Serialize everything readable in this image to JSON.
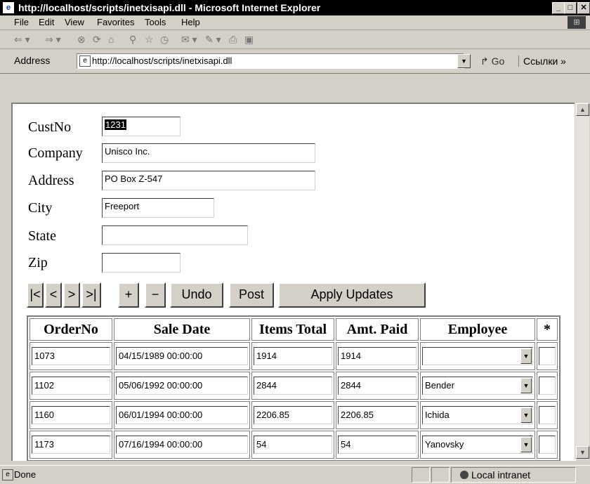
{
  "window": {
    "title": "http://localhost/scripts/inetxisapi.dll - Microsoft Internet Explorer",
    "title_icon": "ie-page-icon",
    "min_icon": "_",
    "max_icon": "□",
    "close_icon": "✕"
  },
  "menu": {
    "items": [
      "File",
      "Edit",
      "View",
      "Favorites",
      "Tools",
      "Help"
    ]
  },
  "toolbar": {
    "icons": [
      "back-icon",
      "forward-icon",
      "stop-icon",
      "refresh-icon",
      "home-icon",
      "search-icon",
      "favorites-icon",
      "history-icon",
      "mail-icon",
      "print-icon",
      "edit-icon"
    ]
  },
  "address": {
    "label": "Address",
    "url": "http://localhost/scripts/inetxisapi.dll",
    "go": "Go",
    "links": "Ссылки »"
  },
  "form": {
    "fields": [
      {
        "label": "CustNo",
        "value": "1231"
      },
      {
        "label": "Company",
        "value": "Unisco Inc."
      },
      {
        "label": "Address",
        "value": "PO Box Z-547"
      },
      {
        "label": "City",
        "value": "Freeport"
      },
      {
        "label": "State",
        "value": ""
      },
      {
        "label": "Zip",
        "value": ""
      }
    ]
  },
  "nav_buttons": {
    "first": "|<",
    "prev": "<",
    "next": ">",
    "last": ">|",
    "insert": "+",
    "delete": "−",
    "undo": "Undo",
    "post": "Post",
    "apply": "Apply Updates"
  },
  "grid": {
    "headers": [
      "OrderNo",
      "Sale Date",
      "Items Total",
      "Amt. Paid",
      "Employee",
      "*"
    ],
    "rows": [
      {
        "order": "1073",
        "date": "04/15/1989 00:00:00",
        "items": "1914",
        "paid": "1914",
        "employee": ""
      },
      {
        "order": "1102",
        "date": "05/06/1992 00:00:00",
        "items": "2844",
        "paid": "2844",
        "employee": "Bender"
      },
      {
        "order": "1160",
        "date": "06/01/1994 00:00:00",
        "items": "2206.85",
        "paid": "2206.85",
        "employee": "Ichida"
      },
      {
        "order": "1173",
        "date": "07/16/1994 00:00:00",
        "items": "54",
        "paid": "54",
        "employee": "Yanovsky"
      }
    ]
  },
  "status": {
    "text": "Done",
    "zone": "Local intranet"
  }
}
